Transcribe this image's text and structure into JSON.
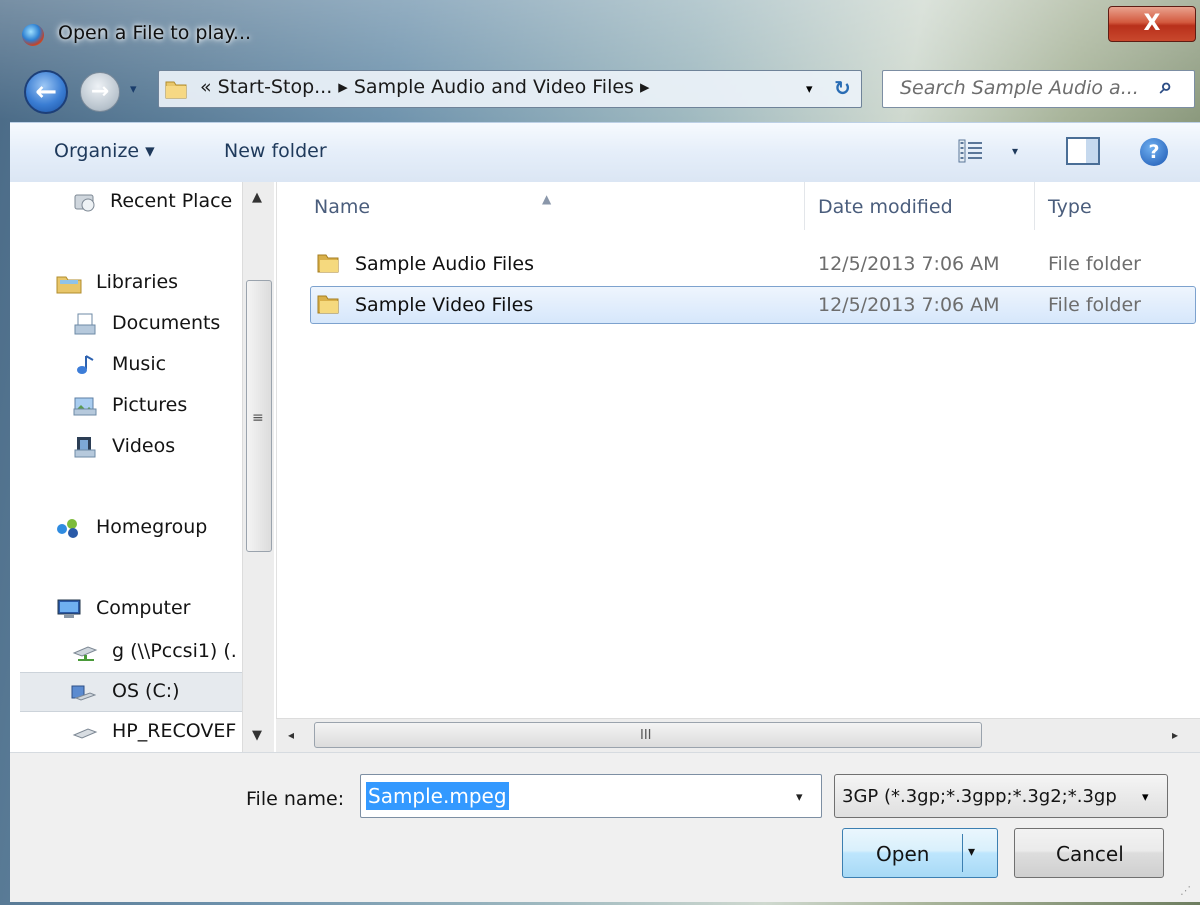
{
  "window": {
    "title": "Open a File to play...",
    "close_label": "X"
  },
  "nav_buttons": {
    "back_glyph": "←",
    "forward_glyph": "→",
    "history_glyph": "▾"
  },
  "address_bar": {
    "path_text": "« Start-Stop... ▸ Sample Audio and Video Files ▸",
    "dropdown_glyph": "▾",
    "refresh_glyph": "↻"
  },
  "search": {
    "placeholder": "Search Sample Audio a...",
    "icon": "search-icon"
  },
  "toolbar": {
    "organize_label": "Organize ▾",
    "new_folder_label": "New folder",
    "views_dropdown": "▾",
    "help_glyph": "?"
  },
  "sidebar": {
    "items": [
      {
        "label": "Recent Place",
        "icon": "recent-places-icon"
      },
      {
        "label": "Libraries",
        "icon": "libraries-icon"
      },
      {
        "label": "Documents",
        "icon": "documents-icon"
      },
      {
        "label": "Music",
        "icon": "music-icon"
      },
      {
        "label": "Pictures",
        "icon": "pictures-icon"
      },
      {
        "label": "Videos",
        "icon": "videos-icon"
      },
      {
        "label": "Homegroup",
        "icon": "homegroup-icon"
      },
      {
        "label": "Computer",
        "icon": "computer-icon"
      },
      {
        "label": "g (\\\\Pccsi1) (.",
        "icon": "network-drive-icon"
      },
      {
        "label": "OS (C:)",
        "icon": "local-disk-icon"
      },
      {
        "label": "HP_RECOVEF",
        "icon": "drive-icon"
      }
    ],
    "selected": "OS (C:)",
    "scroll_up": "▲",
    "scroll_down": "▼",
    "grip": "≡"
  },
  "file_list": {
    "columns": [
      "Name",
      "Date modified",
      "Type"
    ],
    "sort_glyph": "▲",
    "rows": [
      {
        "name": "Sample Audio Files",
        "date": "12/5/2013 7:06 AM",
        "type": "File folder"
      },
      {
        "name": "Sample Video Files",
        "date": "12/5/2013 7:06 AM",
        "type": "File folder"
      }
    ],
    "selected_row": "Sample Video Files",
    "hscroll_left": "◂",
    "hscroll_right": "▸",
    "hscroll_grip": "III"
  },
  "bottom": {
    "file_name_label": "File name:",
    "file_name_value": "Sample.mpeg",
    "file_name_dropdown": "▾",
    "filter_value": "3GP  (*.3gp;*.3gpp;*.3g2;*.3gp",
    "filter_dropdown": "▾",
    "open_label": "Open",
    "open_dropdown": "▾",
    "cancel_label": "Cancel",
    "grip": "⋰"
  },
  "colors": {
    "selection": "#3399ff",
    "close_red": "#c9482d",
    "link_blue": "#1e395b"
  }
}
